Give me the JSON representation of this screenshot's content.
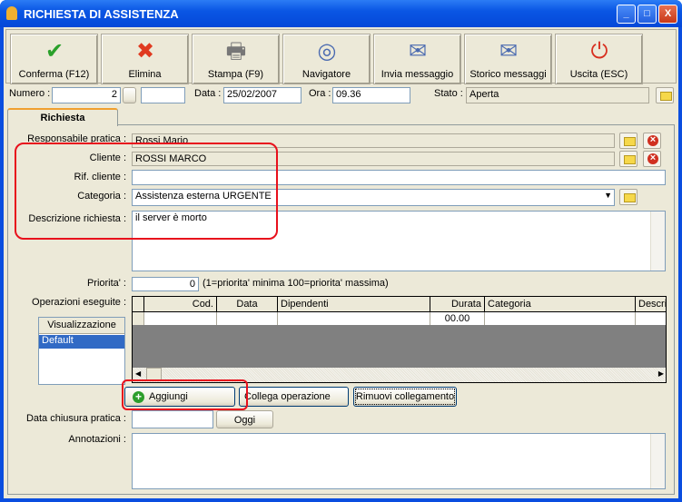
{
  "window": {
    "title": "RICHIESTA DI ASSISTENZA",
    "controls": [
      "_",
      "□",
      "X"
    ]
  },
  "toolbar": [
    {
      "label": "Conferma (F12)",
      "icon": "check-icon",
      "glyph": "✔",
      "color": "#2aa02a"
    },
    {
      "label": "Elimina",
      "icon": "delete-x-icon",
      "glyph": "✖",
      "color": "#e03a20"
    },
    {
      "label": "Stampa (F9)",
      "icon": "printer-icon",
      "glyph": "🖶",
      "color": "#777"
    },
    {
      "label": "Navigatore",
      "icon": "compass-icon",
      "glyph": "◎",
      "color": "#4a6ab0"
    },
    {
      "label": "Invia messaggio",
      "icon": "send-message-icon",
      "glyph": "✉",
      "color": "#4a6ab0"
    },
    {
      "label": "Storico messaggi",
      "icon": "message-history-icon",
      "glyph": "✉",
      "color": "#4a6ab0"
    },
    {
      "label": "Uscita (ESC)",
      "icon": "exit-icon",
      "glyph": "⏻",
      "color": "#d83020"
    }
  ],
  "header": {
    "numero_label": "Numero :",
    "numero": "2",
    "data_label": "Data :",
    "data": "25/02/2007",
    "ora_label": "Ora :",
    "ora": "09.36",
    "stato_label": "Stato :",
    "stato": "Aperta"
  },
  "tab": "Richiesta",
  "form": {
    "responsabile_label": "Responsabile pratica :",
    "responsabile": "Rossi Mario",
    "cliente_label": "Cliente :",
    "cliente": "ROSSI MARCO",
    "rif_label": "Rif. cliente :",
    "rif": "",
    "categoria_label": "Categoria :",
    "categoria": "Assistenza esterna URGENTE",
    "descrizione_label": "Descrizione richiesta :",
    "descrizione": "il server è morto",
    "priorita_label": "Priorita' :",
    "priorita": "0",
    "priorita_hint": "(1=priorita' minima  100=priorita' massima)",
    "operazioni_label": "Operazioni eseguite :",
    "chiusura_label": "Data chiusura pratica :",
    "chiusura": "",
    "oggi": "Oggi",
    "annotazioni_label": "Annotazioni :",
    "annotazioni": ""
  },
  "grid": {
    "columns": [
      "Cod.",
      "Data",
      "Dipendenti",
      "Durata",
      "Categoria",
      "Descrizio"
    ],
    "rows": [
      [
        "",
        "",
        "",
        "00.00",
        "",
        ""
      ]
    ]
  },
  "view": {
    "header": "Visualizzazione",
    "items": [
      "Default"
    ]
  },
  "buttons": {
    "aggiungi": "Aggiungi",
    "collega": "Collega operazione",
    "rimuovi": "Rimuovi collegamento"
  }
}
